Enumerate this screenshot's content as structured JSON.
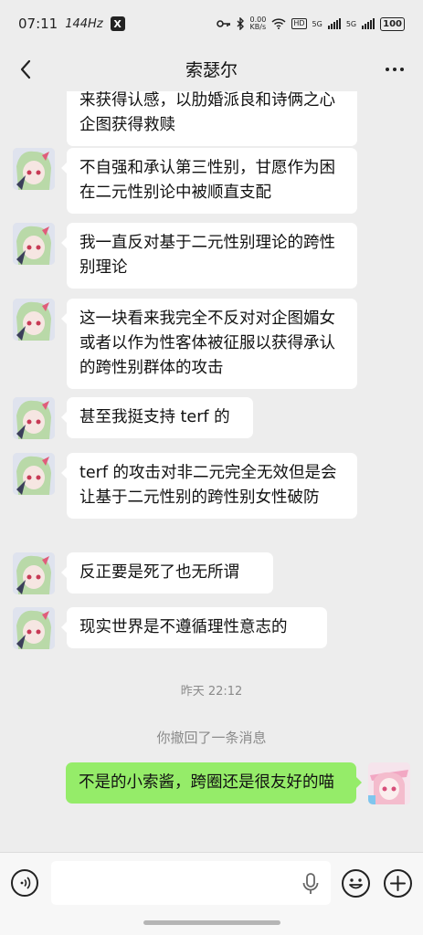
{
  "status_bar": {
    "time": "07:11",
    "refresh_rate": "144Hz",
    "app_badge": "X",
    "speed_value": "0.00",
    "speed_unit": "KB/s",
    "hd1": "HD",
    "hd2": "HD",
    "net1": "5G",
    "net2": "5G",
    "battery": "100"
  },
  "header": {
    "title": "索瑟尔",
    "back_icon": "chevron-left-icon",
    "more_icon": "more-dots-icon"
  },
  "messages": [
    {
      "from": "other",
      "text": "来获得认感，以肋婚派良和诗俩之心企图获得救赎"
    },
    {
      "from": "other",
      "text": "不自强和承认第三性别，甘愿作为困在二元性别论中被顺直支配"
    },
    {
      "from": "other",
      "text": "我一直反对基于二元性别理论的跨性别理论"
    },
    {
      "from": "other",
      "text": "这一块看来我完全不反对对企图媚女或者以作为性客体被征服以获得承认的跨性别群体的攻击"
    },
    {
      "from": "other",
      "text": "甚至我挺支持 terf 的"
    },
    {
      "from": "other",
      "text": "terf 的攻击对非二元完全无效但是会让基于二元性别的跨性别女性破防"
    },
    {
      "from": "other",
      "text": "反正要是死了也无所谓"
    },
    {
      "from": "other",
      "text": "现实世界是不遵循理性意志的"
    },
    {
      "from": "self",
      "text": "不是的小索酱，跨圈还是很友好的喵"
    }
  ],
  "timestamp": "昨天 22:12",
  "system_message": "你撤回了一条消息",
  "input_bar": {
    "placeholder": "",
    "voice_icon": "voice-icon",
    "mic_icon": "microphone-icon",
    "emoji_icon": "emoji-icon",
    "plus_icon": "plus-icon"
  },
  "colors": {
    "background": "#ededed",
    "received_bubble": "#ffffff",
    "sent_bubble": "#95ec69",
    "meta_text": "#8a8a8a"
  }
}
